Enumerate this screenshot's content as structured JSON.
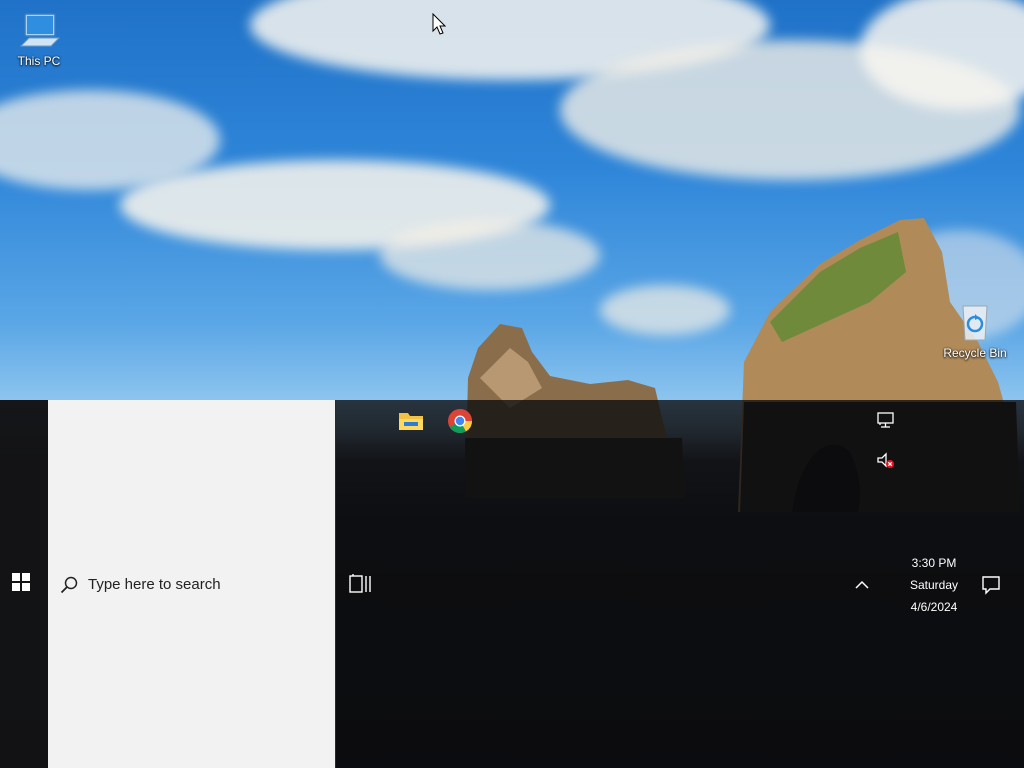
{
  "desktop": {
    "icons": [
      {
        "label": "This PC",
        "icon": "computer-icon"
      },
      {
        "label": "Recycle Bin",
        "icon": "recycle-bin-icon"
      }
    ]
  },
  "taskbar": {
    "start_icon": "windows-logo-icon",
    "search": {
      "placeholder": "Type here to search",
      "icon": "magnifier-icon"
    },
    "task_view_icon": "task-view-icon",
    "pinned_apps": [
      {
        "name": "File Explorer",
        "icon": "folder-icon"
      },
      {
        "name": "Google Chrome",
        "icon": "chrome-icon"
      }
    ],
    "tray": {
      "network_icon": "network-wired-icon",
      "volume_icon": "volume-muted-icon",
      "chevron_icon": "chevron-up-icon",
      "notifications_icon": "action-center-icon"
    },
    "clock": {
      "time": "3:30 PM",
      "day": "Saturday",
      "date": "4/6/2024"
    }
  },
  "colors": {
    "taskbar_bg": "#0c0c0e",
    "search_bg": "#f2f2f2",
    "text_light": "#ffffff",
    "text_dark": "#222222",
    "windows_accent": "#0078d7"
  }
}
